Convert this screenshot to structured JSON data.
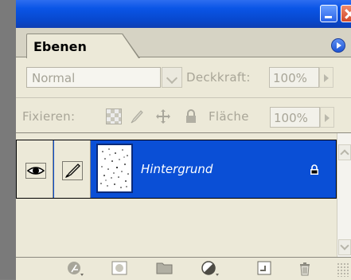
{
  "panel": {
    "tab_label": "Ebenen"
  },
  "blend": {
    "mode": "Normal",
    "opacity_label": "Deckkraft:",
    "opacity_value": "100%"
  },
  "locks": {
    "label": "Fixieren:",
    "fill_label": "Fläche",
    "fill_value": "100%"
  },
  "layers": [
    {
      "name": "Hintergrund",
      "visible": true,
      "locked": true,
      "selected": true
    }
  ],
  "colors": {
    "titlebar": "#0a55e6",
    "selection": "#0a4fd6",
    "panel_bg": "#ece9d8"
  },
  "icons": {
    "titlebar": [
      "minimize-icon",
      "close-icon"
    ],
    "panel_menu": "panel-menu-icon",
    "locks": [
      "lock-transparent-icon",
      "lock-image-icon",
      "lock-position-icon",
      "lock-all-icon"
    ],
    "layer": [
      "eye-icon",
      "brush-icon",
      "lock-icon"
    ],
    "bottom_bar": [
      "layer-style-icon",
      "layer-mask-icon",
      "new-group-icon",
      "adjustment-layer-icon",
      "new-layer-icon",
      "trash-icon"
    ]
  }
}
